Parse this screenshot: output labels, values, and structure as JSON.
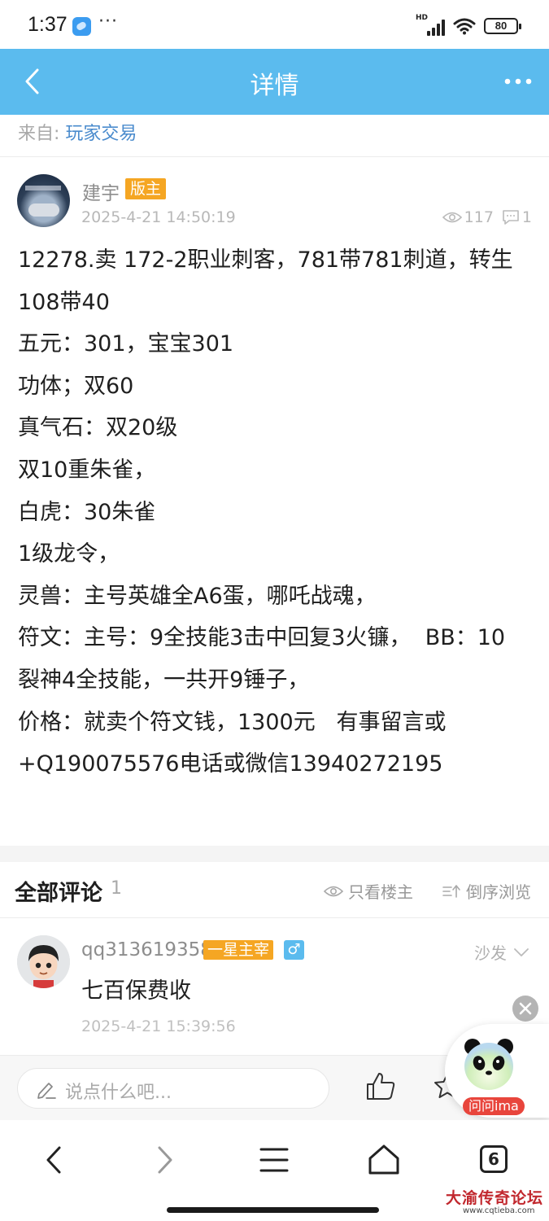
{
  "status_bar": {
    "time": "1:37",
    "dots": "···",
    "network": "HD",
    "battery": "80"
  },
  "header": {
    "title": "详情",
    "back_icon": "chevron-left-icon",
    "more_icon": "more-dots-icon"
  },
  "source": {
    "prefix": "来自: ",
    "forum": "玩家交易"
  },
  "post": {
    "author": "建宇",
    "badge": "版主",
    "time": "2025-4-21 14:50:19",
    "views": "117",
    "replies": "1",
    "lines": [
      "12278.卖 172-2职业刺客，781带781刺道，转生",
      "108带40",
      "五元：301，宝宝301",
      "功体；双60",
      "真气石：双20级",
      "双10重朱雀，",
      "白虎：30朱雀",
      "1级龙令，",
      "灵兽：主号英雄全A6蛋，哪吒战魂，",
      "符文：主号：9全技能3击中回复3火镰，  BB：10",
      "裂神4全技能，一共开9锤子，",
      "价格：就卖个符文钱，1300元   有事留言或",
      "+Q190075576电话或微信13940272195"
    ]
  },
  "comments_header": {
    "title": "全部评论",
    "count": "1",
    "only_op": "只看楼主",
    "reverse": "倒序浏览"
  },
  "comments": [
    {
      "author": "qq313619358",
      "rank": "一星主宰",
      "gender": "♂",
      "floor": "沙发",
      "text": "七百保费收",
      "time": "2025-4-21 15:39:56"
    }
  ],
  "input": {
    "placeholder": "说点什么吧..."
  },
  "float_widget": {
    "label": "问问ima"
  },
  "nav": {
    "tab_count": "6"
  },
  "watermark": {
    "text": "大渝传奇论坛",
    "url": "www.cqtieba.com"
  },
  "colors": {
    "header_bg": "#5bbbee",
    "badge_bg": "#f5a623",
    "link": "#4a8bcd",
    "ima_red": "#e8453c"
  }
}
